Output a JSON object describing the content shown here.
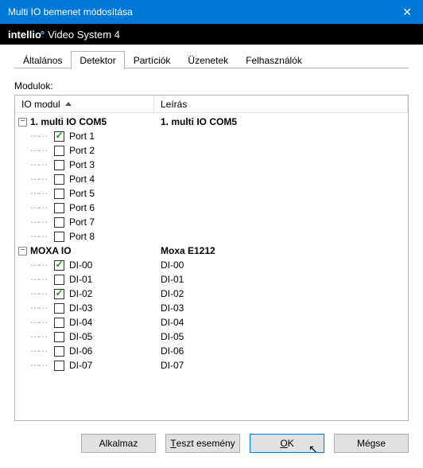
{
  "window": {
    "title": "Multi IO bemenet módosítása",
    "close_glyph": "✕"
  },
  "brand": {
    "name": "intellio",
    "rest": "Video System 4"
  },
  "tabs": {
    "general": "Általános",
    "detector": "Detektor",
    "partitions": "Partíciók",
    "messages": "Üzenetek",
    "users": "Felhasználók",
    "active": "detector"
  },
  "labels": {
    "modulok": "Modulok:",
    "io_header": "IO modul",
    "desc_header": "Leírás"
  },
  "groups": [
    {
      "name": "1. multi IO COM5",
      "desc": "1. multi IO COM5",
      "children": [
        {
          "label": "Port 1",
          "desc": "",
          "checked": true
        },
        {
          "label": "Port 2",
          "desc": "",
          "checked": false
        },
        {
          "label": "Port 3",
          "desc": "",
          "checked": false
        },
        {
          "label": "Port 4",
          "desc": "",
          "checked": false
        },
        {
          "label": "Port 5",
          "desc": "",
          "checked": false
        },
        {
          "label": "Port 6",
          "desc": "",
          "checked": false
        },
        {
          "label": "Port 7",
          "desc": "",
          "checked": false
        },
        {
          "label": "Port 8",
          "desc": "",
          "checked": false
        }
      ]
    },
    {
      "name": "MOXA IO",
      "desc": "Moxa E1212",
      "children": [
        {
          "label": "DI-00",
          "desc": "DI-00",
          "checked": true
        },
        {
          "label": "DI-01",
          "desc": "DI-01",
          "checked": false
        },
        {
          "label": "DI-02",
          "desc": "DI-02",
          "checked": true
        },
        {
          "label": "DI-03",
          "desc": "DI-03",
          "checked": false
        },
        {
          "label": "DI-04",
          "desc": "DI-04",
          "checked": false
        },
        {
          "label": "DI-05",
          "desc": "DI-05",
          "checked": false
        },
        {
          "label": "DI-06",
          "desc": "DI-06",
          "checked": false
        },
        {
          "label": "DI-07",
          "desc": "DI-07",
          "checked": false
        }
      ]
    }
  ],
  "buttons": {
    "apply": "Alkalmaz",
    "test": "Teszt esemény",
    "ok": "OK",
    "cancel": "Mégse"
  }
}
